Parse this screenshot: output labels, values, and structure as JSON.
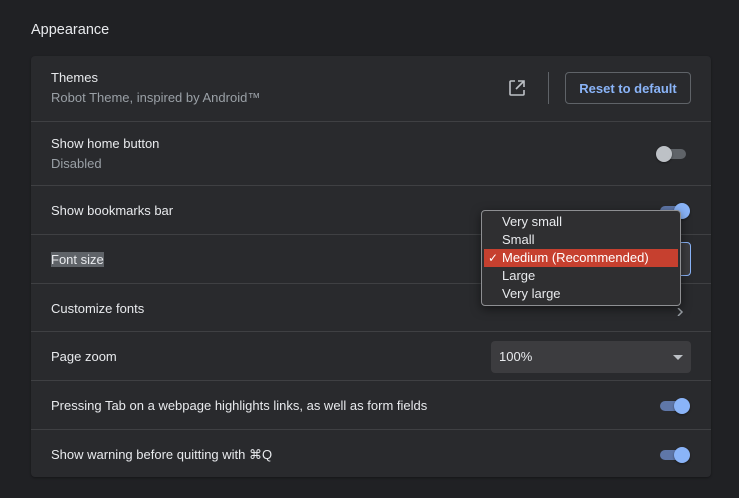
{
  "section": {
    "title": "Appearance"
  },
  "themes": {
    "label": "Themes",
    "sublabel": "Robot Theme, inspired by Android™",
    "reset_label": "Reset to default"
  },
  "home_button": {
    "label": "Show home button",
    "sublabel": "Disabled",
    "enabled": false
  },
  "bookmarks_bar": {
    "label": "Show bookmarks bar",
    "enabled": true
  },
  "font_size": {
    "label": "Font size",
    "options": [
      "Very small",
      "Small",
      "Medium (Recommended)",
      "Large",
      "Very large"
    ],
    "selected_index": 2,
    "check_glyph": "✓"
  },
  "customize_fonts": {
    "label": "Customize fonts"
  },
  "page_zoom": {
    "label": "Page zoom",
    "value": "100%"
  },
  "tab_highlight": {
    "label": "Pressing Tab on a webpage highlights links, as well as form fields",
    "enabled": true
  },
  "quit_warning": {
    "label": "Show warning before quitting with ⌘Q",
    "enabled": true
  },
  "colors": {
    "accent": "#8ab4f8",
    "selection_highlight": "#c6402f",
    "background": "#202124",
    "card": "#292a2d"
  }
}
